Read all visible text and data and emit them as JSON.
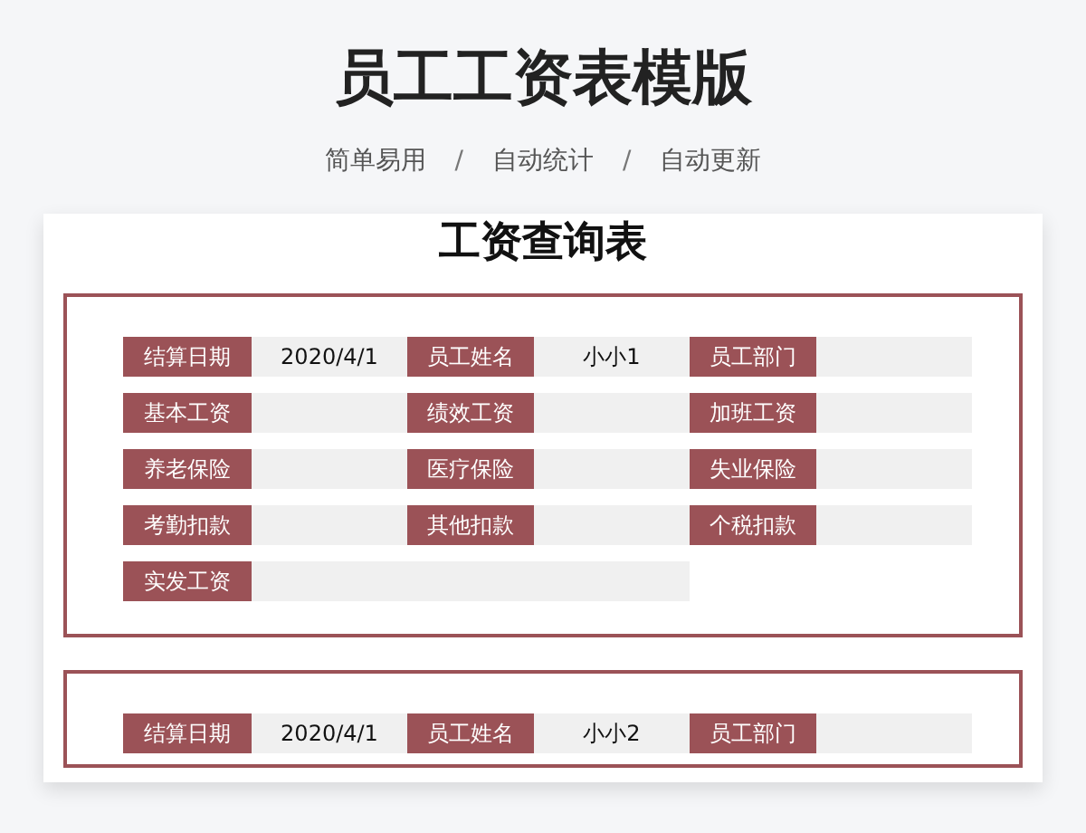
{
  "header": {
    "title": "员工工资表模版",
    "features": [
      "简单易用",
      "自动统计",
      "自动更新"
    ],
    "separator": "/"
  },
  "sheet": {
    "title": "工资查询表",
    "records": [
      {
        "fields": [
          {
            "label": "结算日期",
            "value": "2020/4/1"
          },
          {
            "label": "员工姓名",
            "value": "小小1"
          },
          {
            "label": "员工部门"
          },
          {
            "label": "基本工资"
          },
          {
            "label": "绩效工资"
          },
          {
            "label": "加班工资"
          },
          {
            "label": "养老保险"
          },
          {
            "label": "医疗保险"
          },
          {
            "label": "失业保险"
          },
          {
            "label": "考勤扣款"
          },
          {
            "label": "其他扣款"
          },
          {
            "label": "个税扣款"
          },
          {
            "label": "实发工资",
            "kind": "wide"
          }
        ]
      },
      {
        "fields": [
          {
            "label": "结算日期",
            "value": "2020/4/1"
          },
          {
            "label": "员工姓名",
            "value": "小小2"
          },
          {
            "label": "员工部门"
          }
        ]
      }
    ]
  }
}
